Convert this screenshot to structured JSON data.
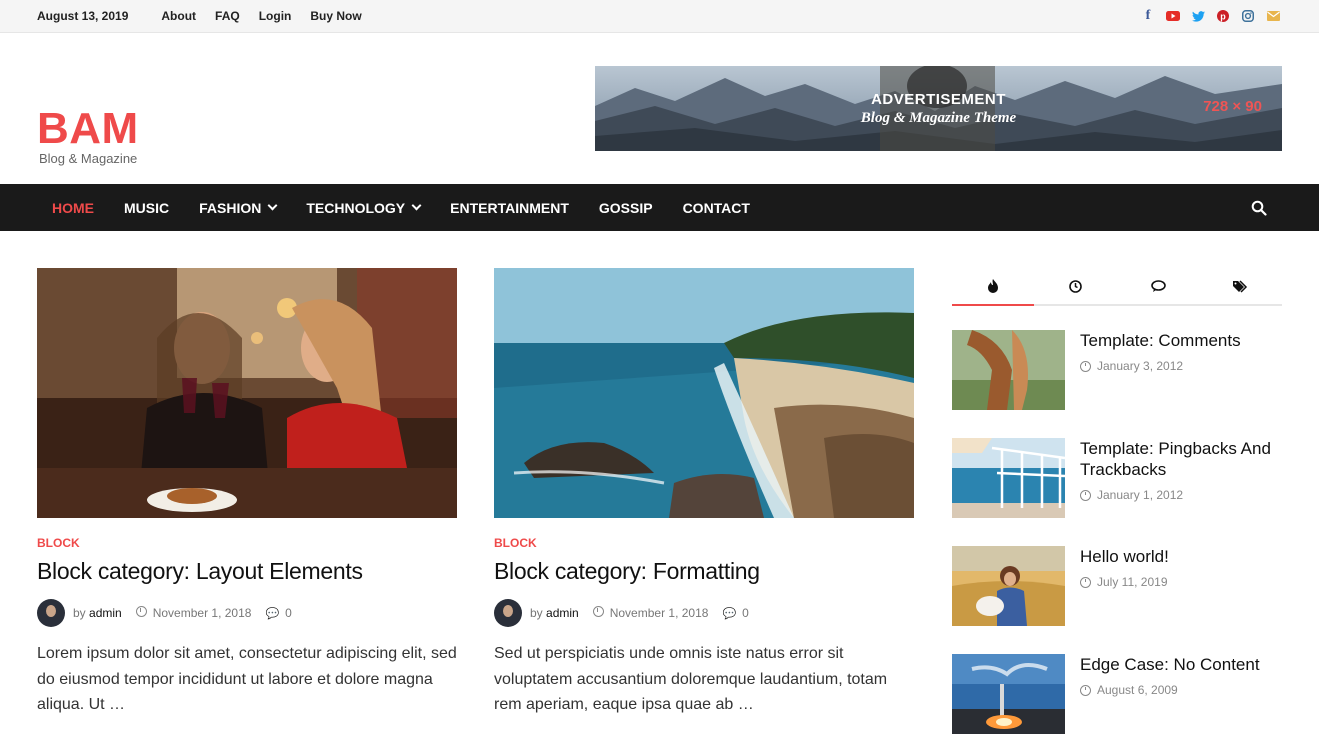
{
  "topbar": {
    "date": "August 13, 2019",
    "links": [
      "About",
      "FAQ",
      "Login",
      "Buy Now"
    ],
    "social": [
      {
        "icon": "facebook-icon",
        "glyph": "f",
        "color": "#3b5998"
      },
      {
        "icon": "youtube-icon",
        "glyph": "▶",
        "color": "#e52d27"
      },
      {
        "icon": "twitter-icon",
        "glyph": "🐦",
        "color": "#1da1f2"
      },
      {
        "icon": "pinterest-icon",
        "glyph": "P",
        "color": "#cb2027"
      },
      {
        "icon": "instagram-icon",
        "glyph": "◎",
        "color": "#3f729b"
      },
      {
        "icon": "email-icon",
        "glyph": "✉",
        "color": "#e8b54d"
      }
    ]
  },
  "logo": {
    "name": "BAM",
    "tagline": "Blog & Magazine"
  },
  "ad": {
    "line1": "ADVERTISEMENT",
    "line2": "Blog & Magazine Theme",
    "size": "728 × 90"
  },
  "nav": {
    "items": [
      {
        "label": "HOME",
        "active": true,
        "dropdown": false
      },
      {
        "label": "MUSIC",
        "active": false,
        "dropdown": false
      },
      {
        "label": "FASHION",
        "active": false,
        "dropdown": true
      },
      {
        "label": "TECHNOLOGY",
        "active": false,
        "dropdown": true
      },
      {
        "label": "ENTERTAINMENT",
        "active": false,
        "dropdown": false
      },
      {
        "label": "GOSSIP",
        "active": false,
        "dropdown": false
      },
      {
        "label": "CONTACT",
        "active": false,
        "dropdown": false
      }
    ]
  },
  "posts": [
    {
      "category": "BLOCK",
      "title": "Block category: Layout Elements",
      "by": "by",
      "author": "admin",
      "date": "November 1, 2018",
      "comments": "0",
      "excerpt": "Lorem ipsum dolor sit amet, consectetur adipiscing elit, sed do eiusmod tempor incididunt ut labore et dolore magna aliqua. Ut …"
    },
    {
      "category": "BLOCK",
      "title": "Block category: Formatting",
      "by": "by",
      "author": "admin",
      "date": "November 1, 2018",
      "comments": "0",
      "excerpt": "Sed ut perspiciatis unde omnis iste natus error sit voluptatem accusantium doloremque laudantium, totam rem aperiam, eaque ipsa quae ab …"
    }
  ],
  "sidebar": {
    "tabs": [
      {
        "icon": "flame-icon",
        "glyph": "🔥"
      },
      {
        "icon": "clock-icon",
        "glyph": "◷"
      },
      {
        "icon": "comments-icon",
        "glyph": "💬"
      },
      {
        "icon": "tags-icon",
        "glyph": "🏷"
      }
    ],
    "items": [
      {
        "title": "Template: Comments",
        "date": "January 3, 2012"
      },
      {
        "title": "Template: Pingbacks And Trackbacks",
        "date": "January 1, 2012"
      },
      {
        "title": "Hello world!",
        "date": "July 11, 2019"
      },
      {
        "title": "Edge Case: No Content",
        "date": "August 6, 2009"
      }
    ]
  },
  "colors": {
    "accent": "#ef4a4a",
    "nav_bg": "#1a1a1a"
  }
}
